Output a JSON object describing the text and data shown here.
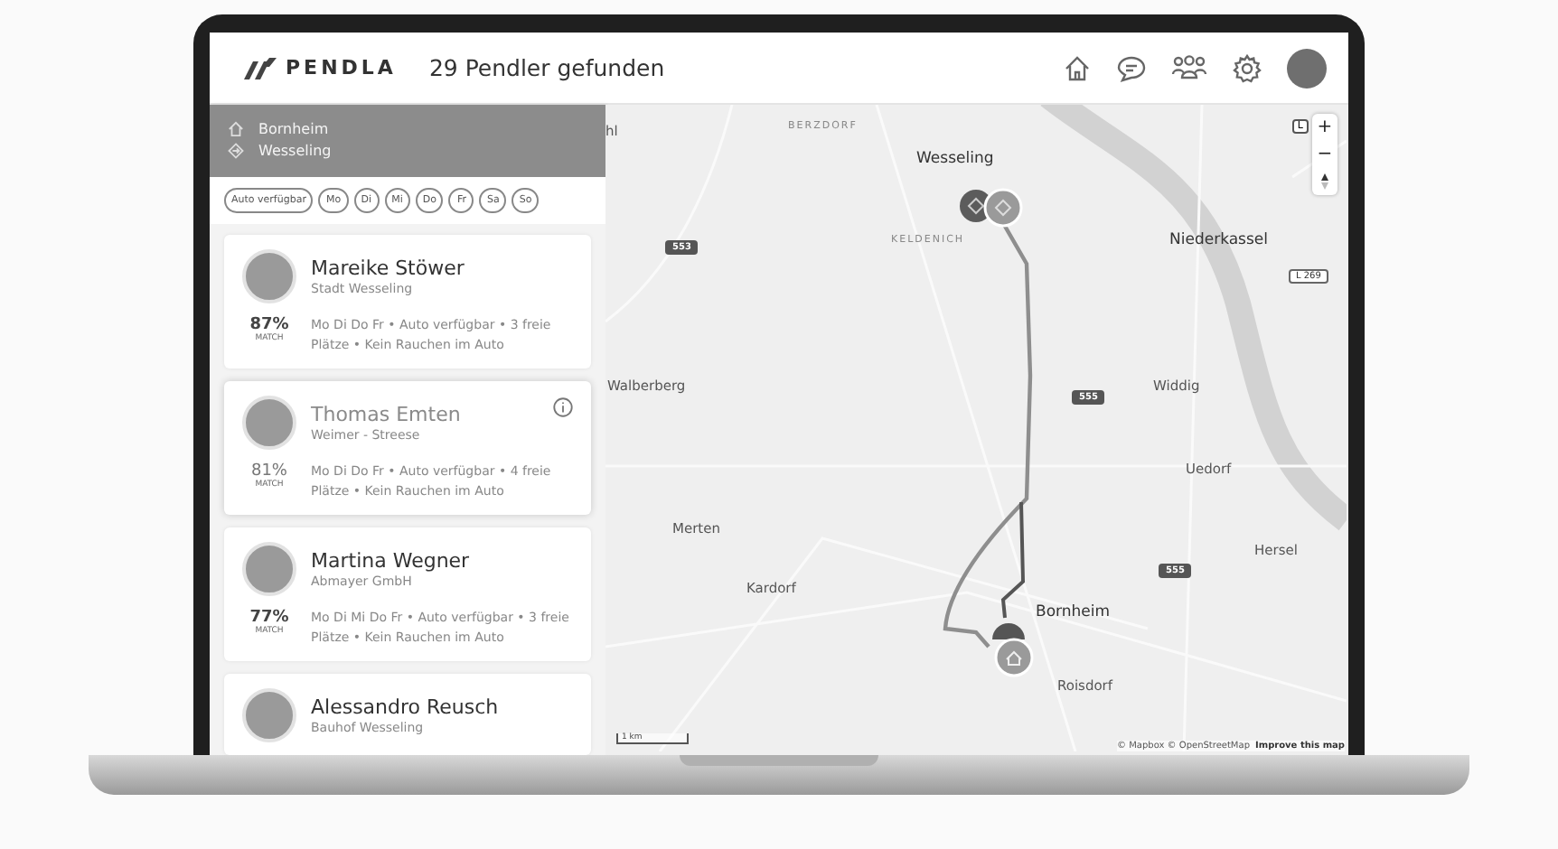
{
  "header": {
    "brand": "PENDLA",
    "title": "29 Pendler gefunden"
  },
  "route": {
    "from": "Bornheim",
    "to": "Wesseling"
  },
  "filters": [
    {
      "label": "Auto verfügbar",
      "selected": false
    },
    {
      "label": "Mo",
      "selected": false
    },
    {
      "label": "Di",
      "selected": false
    },
    {
      "label": "Mi",
      "selected": false
    },
    {
      "label": "Do",
      "selected": false
    },
    {
      "label": "Fr",
      "selected": false
    },
    {
      "label": "Sa",
      "selected": false
    },
    {
      "label": "So",
      "selected": false
    }
  ],
  "cards": [
    {
      "name": "Mareike Stöwer",
      "subtitle": "Stadt Wesseling",
      "match": "87%",
      "match_label": "MATCH",
      "details": "Mo Di Do Fr • Auto verfügbar • 3 freie Plätze • Kein Rauchen im Auto",
      "selected": false
    },
    {
      "name": "Thomas Emten",
      "subtitle": "Weimer - Streese",
      "match": "81%",
      "match_label": "MATCH",
      "details": "Mo Di Do Fr • Auto verfügbar • 4 freie Plätze • Kein Rauchen im Auto",
      "selected": true
    },
    {
      "name": "Martina Wegner",
      "subtitle": "Abmayer GmbH",
      "match": "77%",
      "match_label": "MATCH",
      "details": "Mo Di Mi Do Fr • Auto verfügbar • 3 freie Plätze • Kein Rauchen im Auto",
      "selected": false
    },
    {
      "name": "Alessandro Reusch",
      "subtitle": "Bauhof Wesseling",
      "selected": false
    }
  ],
  "map": {
    "labels": [
      {
        "text": "hl",
        "kind": "town"
      },
      {
        "text": "BERZDORF",
        "kind": "district"
      },
      {
        "text": "Wesseling",
        "kind": "city"
      },
      {
        "text": "KELDENICH",
        "kind": "district"
      },
      {
        "text": "553",
        "kind": "road"
      },
      {
        "text": "Niederkassel",
        "kind": "city"
      },
      {
        "text": "L 269",
        "kind": "sign"
      },
      {
        "text": "Walberberg",
        "kind": "town"
      },
      {
        "text": "555",
        "kind": "road"
      },
      {
        "text": "Widdig",
        "kind": "town"
      },
      {
        "text": "Uedorf",
        "kind": "town"
      },
      {
        "text": "Merten",
        "kind": "town"
      },
      {
        "text": "Hersel",
        "kind": "town"
      },
      {
        "text": "555",
        "kind": "road"
      },
      {
        "text": "Kardorf",
        "kind": "town"
      },
      {
        "text": "Bornheim",
        "kind": "city"
      },
      {
        "text": "Roisdorf",
        "kind": "town"
      }
    ],
    "scale": "1 km",
    "attribution": "© Mapbox © OpenStreetMap",
    "improve_link": "Improve this map",
    "layer_badge": "L",
    "zoom_in": "+",
    "zoom_out": "−"
  }
}
